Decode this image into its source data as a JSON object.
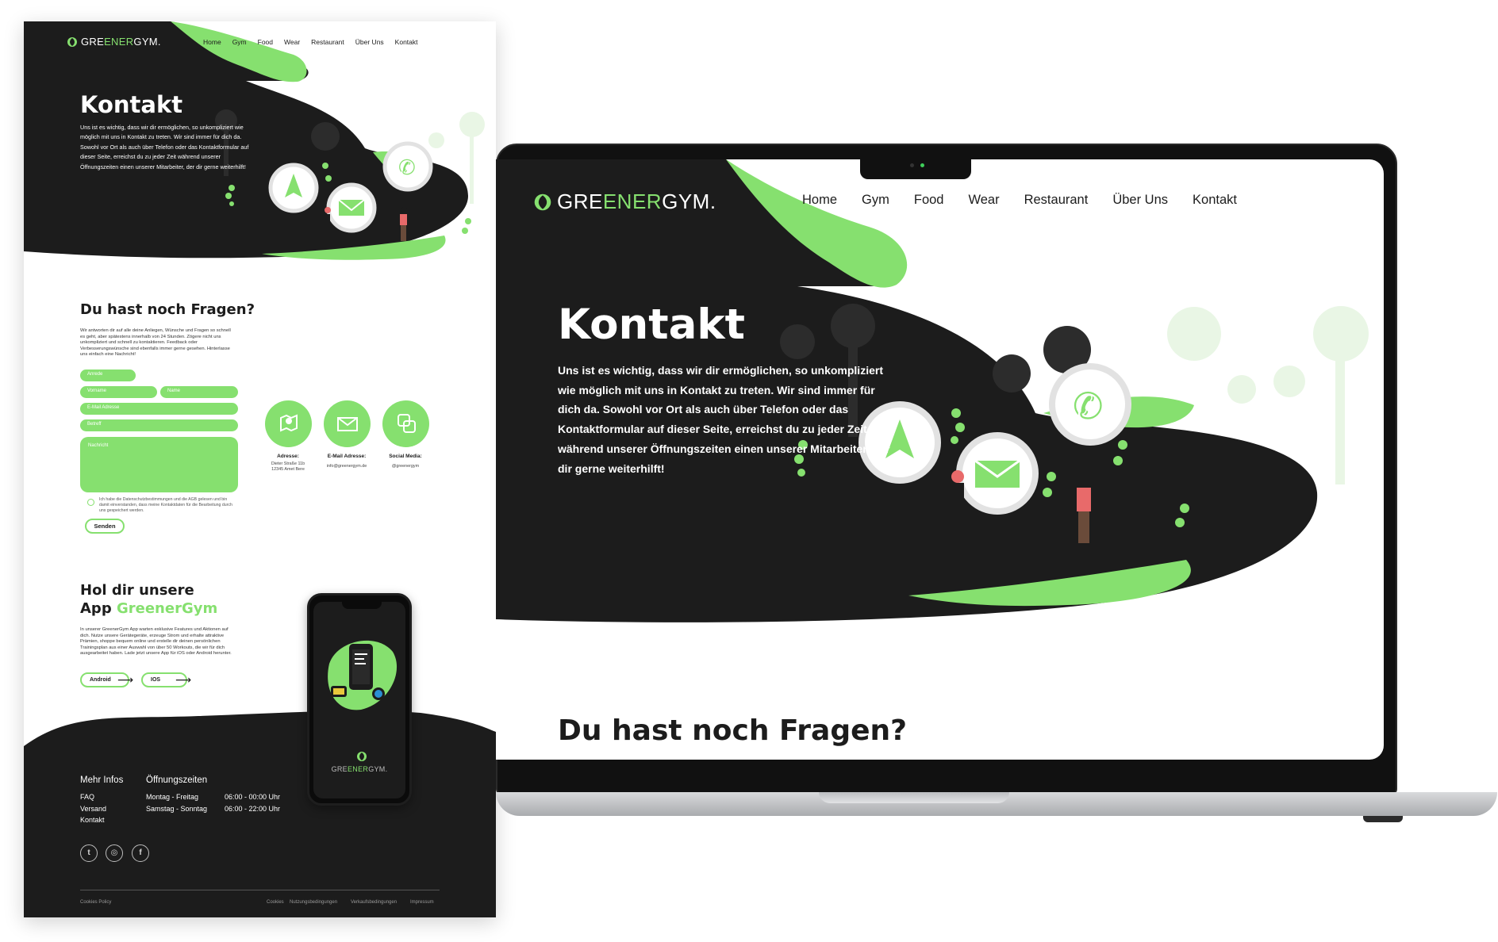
{
  "brand": {
    "name_pre": "GRE",
    "name_mid": "ENER",
    "name_post": "GYM."
  },
  "nav": [
    "Home",
    "Gym",
    "Food",
    "Wear",
    "Restaurant",
    "Über Uns",
    "Kontakt"
  ],
  "hero": {
    "title": "Kontakt",
    "text": "Uns ist es wichtig, dass wir dir ermöglichen, so unkompliziert wie möglich mit uns in Kontakt zu treten. Wir sind immer für dich da. Sowohl vor Ort als auch über Telefon oder das Kontaktformular auf dieser Seite, erreichst du zu jeder Zeit während unserer Öffnungszeiten einen unserer Mitarbeiter, der dir gerne weiterhilft!"
  },
  "questions": {
    "heading": "Du hast noch Fragen?",
    "intro": "Wir antworten dir auf alle deine Anliegen, Wünsche und Fragen so schnell es geht, aber spätestens innerhalb von 24 Stunden. Zögere nicht uns unkompliziert und schnell zu kontaktieren. Feedback oder Verbesserungswünsche sind ebenfalls immer gerne gesehen. Hinterlasse uns einfach eine Nachricht!"
  },
  "form": {
    "anrede": "Anrede",
    "vorname": "Vorname",
    "name": "Name",
    "email": "E-Mail Adresse",
    "betreff": "Betreff",
    "nachricht": "Nachricht",
    "consent": "Ich habe die Datenschutzbestimmungen und die AGB gelesen und bin damit einverstanden, dass meine Kontaktdaten für die Bearbeitung durch uns gespeichert werden.",
    "submit": "Senden"
  },
  "contact_info": [
    {
      "label": "Adresse:",
      "value": "Dieter Straße 11b\n12345 Amet Bere",
      "icon": "map-icon"
    },
    {
      "label": "E-Mail Adresse:",
      "value": "info@greenergym.de",
      "icon": "mail-icon"
    },
    {
      "label": "Social Media:",
      "value": "@greenergym",
      "icon": "social-icon"
    }
  ],
  "app": {
    "title_line1": "Hol dir unsere",
    "title_app": "App",
    "title_brand": "GreenerGym",
    "text": "In unserer GreenerGym App warten exklusive Features und Aktionen auf dich. Nutze unsere Gerätegeräte, erzeuge Strom und erhalte attraktive Prämien, shoppe bequem online und erstelle dir deinen persönlichen Trainingsplan aus einer Auswahl von über 50 Workouts, die wir für dich ausgearbeitet haben. Lade jetzt unsere App für iOS oder Android herunter.",
    "android": "Android",
    "ios": "IOS"
  },
  "footer": {
    "more_heading": "Mehr Infos",
    "more_links": [
      "FAQ",
      "Versand",
      "Kontakt"
    ],
    "hours_heading": "Öffnungszeiten",
    "hours": [
      {
        "days": "Montag - Freitag",
        "time": "06:00 - 00:00 Uhr"
      },
      {
        "days": "Samstag - Sonntag",
        "time": "06:00 - 22:00 Uhr"
      }
    ],
    "social_icons": [
      "twitter-icon",
      "instagram-icon",
      "facebook-icon"
    ],
    "cookie": "Cookies Policy",
    "legal": [
      "Cookies",
      "Nutzungsbedingungen",
      "Verkaufsbedingungen",
      "Impressum"
    ]
  },
  "colors": {
    "accent": "#86e06f",
    "dark": "#1c1c1c",
    "white": "#ffffff"
  }
}
